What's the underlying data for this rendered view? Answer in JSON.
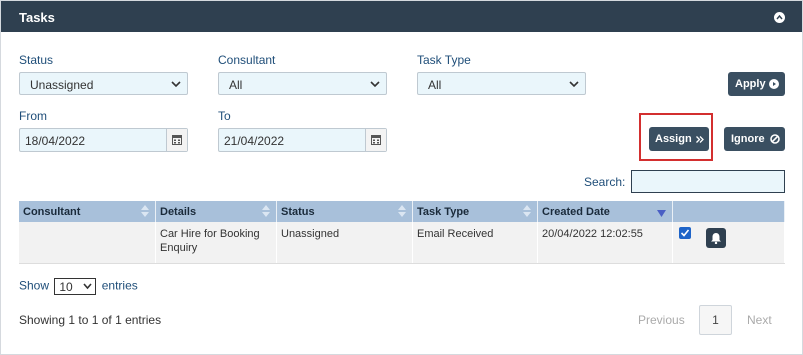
{
  "panel": {
    "title": "Tasks"
  },
  "filters": {
    "status_label": "Status",
    "status_value": "Unassigned",
    "consultant_label": "Consultant",
    "consultant_value": "All",
    "tasktype_label": "Task Type",
    "tasktype_value": "All",
    "from_label": "From",
    "from_value": "18/04/2022",
    "to_label": "To",
    "to_value": "21/04/2022"
  },
  "buttons": {
    "apply": "Apply",
    "assign": "Assign",
    "ignore": "Ignore"
  },
  "search": {
    "label": "Search:",
    "value": ""
  },
  "table": {
    "headers": [
      "Consultant",
      "Details",
      "Status",
      "Task Type",
      "Created Date"
    ],
    "rows": [
      {
        "consultant": "",
        "details": "Car Hire for Booking Enquiry",
        "status": "Unassigned",
        "task_type": "Email Received",
        "created": "20/04/2022 12:02:55",
        "checked": true
      }
    ]
  },
  "footer": {
    "show_prefix": "Show",
    "page_size": "10",
    "show_suffix": "entries",
    "info": "Showing 1 to 1 of 1 entries",
    "previous": "Previous",
    "page": "1",
    "next": "Next"
  },
  "colors": {
    "header_bg": "#2f4050",
    "button_bg": "#3a4f61",
    "highlight": "#d32f2f",
    "table_header": "#a8c0da",
    "checkbox": "#1e64c8"
  },
  "icons": {
    "collapse": "chevron-up-icon",
    "calendar": "calendar-icon",
    "apply": "play-circle-icon",
    "assign": "double-chevron-right-icon",
    "ignore": "ban-icon",
    "bell": "bell-icon",
    "sort": "sort-icon"
  }
}
